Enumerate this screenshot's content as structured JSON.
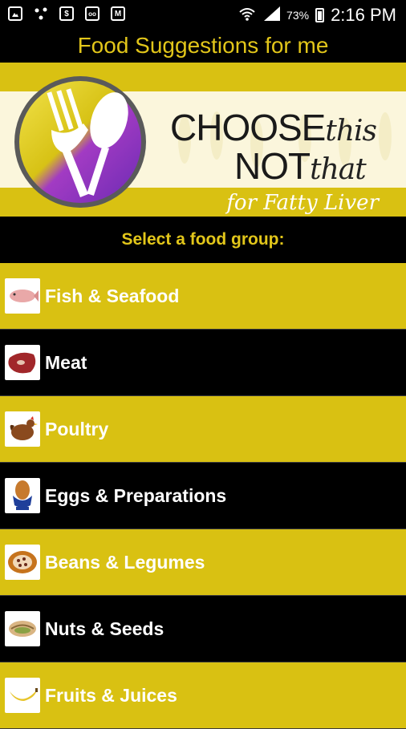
{
  "status_bar": {
    "battery_percent": "73%",
    "time": "2:16 PM",
    "icons": [
      "image-icon",
      "share-dots-icon",
      "dollar-box-icon",
      "voicemail-icon",
      "gmail-icon",
      "wifi-icon",
      "signal-icon",
      "battery-icon"
    ]
  },
  "app": {
    "title": "Food Suggestions for me"
  },
  "banner": {
    "line1_bold": "CHOOSE",
    "line1_script": "this",
    "line2_bold": "NOT",
    "line2_script": "that",
    "tagline": "for Fatty Liver"
  },
  "section_label": "Select a food group:",
  "food_groups": [
    {
      "label": "Fish & Seafood",
      "icon": "fish-icon"
    },
    {
      "label": "Meat",
      "icon": "steak-icon"
    },
    {
      "label": "Poultry",
      "icon": "chicken-icon"
    },
    {
      "label": "Eggs & Preparations",
      "icon": "egg-cup-icon"
    },
    {
      "label": "Beans & Legumes",
      "icon": "beans-icon"
    },
    {
      "label": "Nuts & Seeds",
      "icon": "pistachio-icon"
    },
    {
      "label": "Fruits & Juices",
      "icon": "banana-icon"
    }
  ],
  "colors": {
    "accent_yellow": "#d9c112",
    "title_yellow": "#e2c61a",
    "background": "#000000"
  }
}
